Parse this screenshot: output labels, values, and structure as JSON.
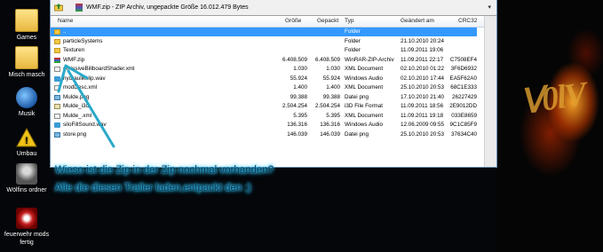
{
  "desktop": {
    "icons": [
      {
        "label": "Games"
      },
      {
        "label": "Misch masch"
      },
      {
        "label": "Musik"
      },
      {
        "label": "Umbau"
      },
      {
        "label": "Wölfins ordner"
      },
      {
        "label": "feuerwehr mods fertig"
      }
    ]
  },
  "window": {
    "path_text": "WMF.zip - ZIP Archiv, ungepackte Größe 16.012.479 Bytes",
    "columns": {
      "name": "Name",
      "size": "Größe",
      "packed": "Gepackt",
      "type": "Typ",
      "modified": "Geändert am",
      "crc": "CRC32"
    },
    "rows": [
      {
        "name": "..",
        "size": "",
        "packed": "",
        "type": "Folder",
        "modified": "",
        "crc": "",
        "icon": "folder",
        "selected": true
      },
      {
        "name": "particleSystems",
        "size": "",
        "packed": "",
        "type": "Folder",
        "modified": "21.10.2010 20:24",
        "crc": "",
        "icon": "folder"
      },
      {
        "name": "Texturen",
        "size": "",
        "packed": "",
        "type": "Folder",
        "modified": "11.09.2011 19:06",
        "crc": "",
        "icon": "folder"
      },
      {
        "name": "WMF.zip",
        "size": "6.408.509",
        "packed": "6.408.509",
        "type": "WinRAR-ZIP-Archiv",
        "modified": "11.09.2011 22:17",
        "crc": "C7508EF4",
        "icon": "zip"
      },
      {
        "name": "emissiveBillboardShader.xml",
        "size": "1.030",
        "packed": "1.030",
        "type": "XML Document",
        "modified": "02.10.2010 01:22",
        "crc": "3F6D6932",
        "icon": "file"
      },
      {
        "name": "hydraulikklip.wav",
        "size": "55.924",
        "packed": "55.924",
        "type": "Windows Audio",
        "modified": "02.10.2010 17:44",
        "crc": "EA5F62A0",
        "icon": "wav"
      },
      {
        "name": "modDesc.xml",
        "size": "1.400",
        "packed": "1.400",
        "type": "XML Document",
        "modified": "25.10.2010 20:53",
        "crc": "68C1E333",
        "icon": "file"
      },
      {
        "name": "Mulde.png",
        "size": "99.388",
        "packed": "99.388",
        "type": "Datei png",
        "modified": "17.10.2010 21:40",
        "crc": "26227429",
        "icon": "png"
      },
      {
        "name": "Mulde_i3d",
        "size": "2.504.254",
        "packed": "2.504.254",
        "type": "i3D File Format",
        "modified": "11.09.2011 18:56",
        "crc": "2E9012DD",
        "icon": "i3d"
      },
      {
        "name": "Mulde_.xml",
        "size": "5.395",
        "packed": "5.395",
        "type": "XML Document",
        "modified": "11.09.2011 19:18",
        "crc": "033E8659",
        "icon": "file"
      },
      {
        "name": "siloFillSound.wav",
        "size": "136.316",
        "packed": "136.316",
        "type": "Windows Audio",
        "modified": "12.06.2009 09:55",
        "crc": "9C1C85F9",
        "icon": "wav"
      },
      {
        "name": "store.png",
        "size": "146.039",
        "packed": "146.039",
        "type": "Datei png",
        "modified": "25.10.2010 20:53",
        "crc": "37634C40",
        "icon": "png"
      }
    ]
  },
  "caption": {
    "line1": "Wieso ist die Zip in der Zip nochmal vorhanden?",
    "line2": "Alle die diesen Trailer laden,entpackt den ;)"
  },
  "colors": {
    "selection": "#3399ff",
    "caption_glow": "#3fd0ff",
    "arrow": "#2aa9c9"
  }
}
